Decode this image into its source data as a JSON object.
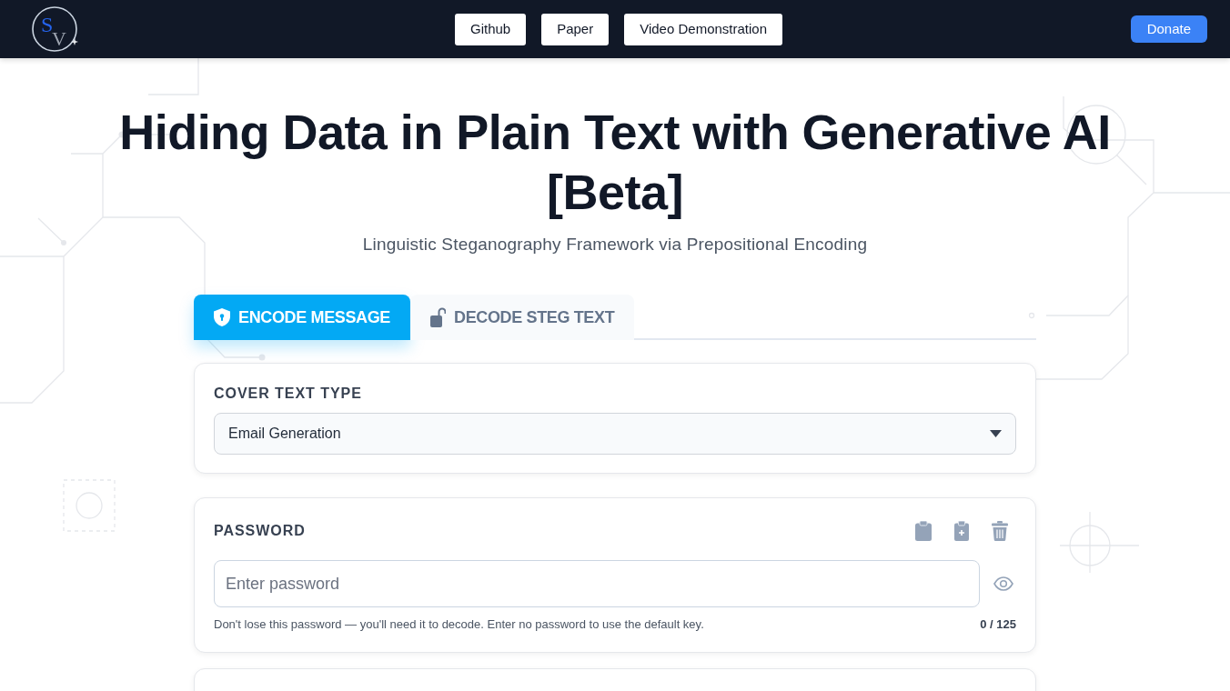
{
  "nav": {
    "logo": {
      "letters": [
        "S",
        "V"
      ]
    },
    "links": [
      {
        "label": "Github"
      },
      {
        "label": "Paper"
      },
      {
        "label": "Video Demonstration"
      }
    ],
    "donate_button": "Donate"
  },
  "hero": {
    "title": "Hiding Data in Plain Text with Generative AI [Beta]",
    "subtitle": "Linguistic Steganography Framework via Prepositional Encoding"
  },
  "tabs": [
    {
      "label": "ENCODE MESSAGE",
      "selected": true
    },
    {
      "label": "DECODE STEG TEXT",
      "selected": false
    }
  ],
  "cover_text_type": {
    "label": "COVER TEXT TYPE",
    "value": "Email Generation"
  },
  "password": {
    "label": "PASSWORD",
    "placeholder": "Enter password",
    "hint": "Don't lose this password — you'll need it to decode. Enter no password to use the default key.",
    "counter": "0 / 125"
  }
}
